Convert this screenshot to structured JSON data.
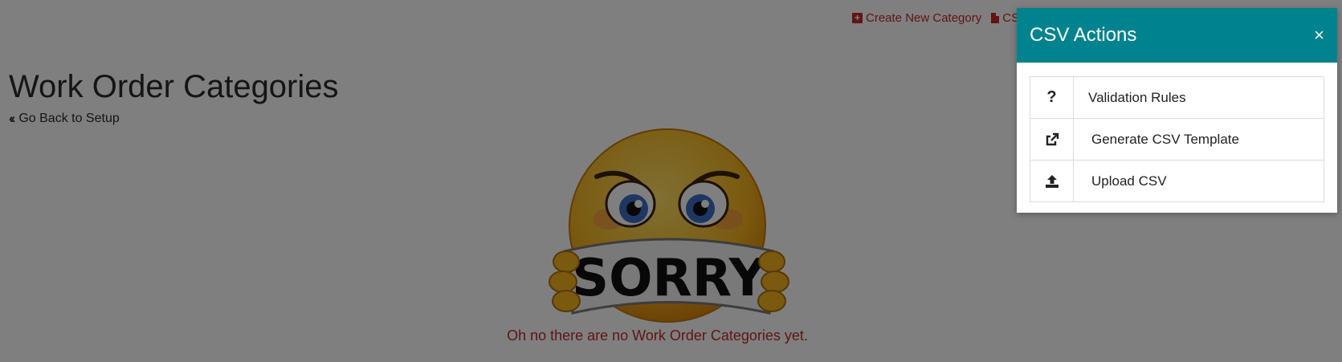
{
  "header": {
    "create_label": "Create New Category",
    "csv_label": "CSV"
  },
  "page": {
    "title": "Work Order Categories",
    "back_label": "Go Back to Setup"
  },
  "empty_state": {
    "image_text": "SORRY",
    "message": "Oh no there are no Work Order Categories yet."
  },
  "modal": {
    "title": "CSV Actions",
    "close_symbol": "×",
    "header_color": "#00838f",
    "actions": [
      {
        "icon": "question-icon",
        "label": "Validation Rules"
      },
      {
        "icon": "external-link-icon",
        "label": "Generate CSV Template"
      },
      {
        "icon": "upload-icon",
        "label": "Upload CSV"
      }
    ]
  },
  "colors": {
    "link": "#c62828",
    "overlay": "rgba(0,0,0,0.5)"
  }
}
